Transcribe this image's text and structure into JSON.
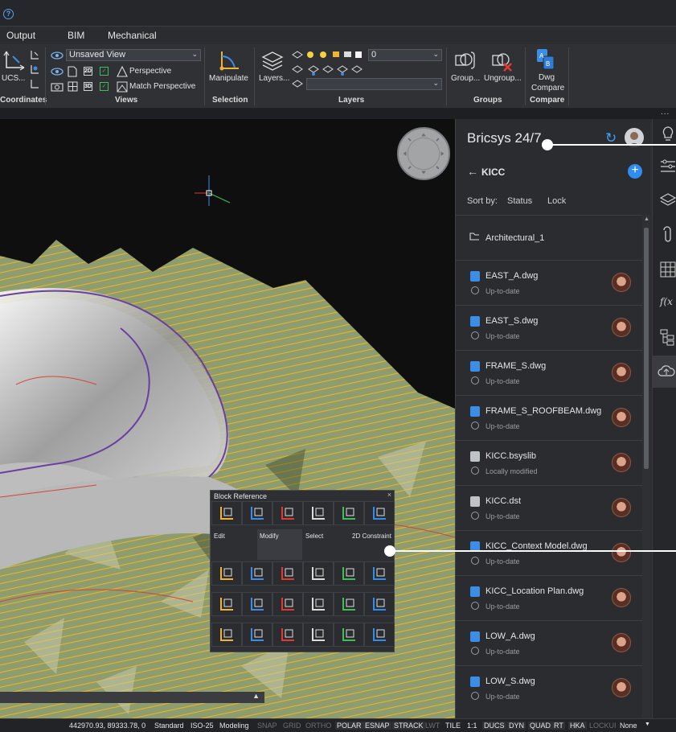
{
  "tabs": [
    "Output",
    "BIM",
    "Mechanical"
  ],
  "ribbon": {
    "coordinates": {
      "ucs_label": "UCS...",
      "group_label": "Coordinates"
    },
    "views": {
      "view_combo": "Unsaved View",
      "perspective": "Perspective",
      "match_perspective": "Match Perspective",
      "group_label": "Views",
      "mini_2d": "2D",
      "mini_3d": "3D"
    },
    "selection": {
      "manipulate": "Manipulate",
      "group_label": "Selection"
    },
    "layers": {
      "layers_btn": "Layers...",
      "layer_value": "0",
      "group_label": "Layers"
    },
    "groups": {
      "group_btn": "Group...",
      "ungroup_btn": "Ungroup...",
      "group_label": "Groups"
    },
    "compare": {
      "dwg_compare": "Dwg Compare",
      "dwg_compare_line1": "Dwg",
      "dwg_compare_line2": "Compare",
      "group_label": "Compare"
    }
  },
  "panel": {
    "title": "Bricsys 24/7",
    "project": "KICC",
    "sort_by": "Sort by:",
    "sort_status": "Status",
    "sort_lock": "Lock",
    "folder": "Architectural_1",
    "files": [
      {
        "name": "EAST_A.dwg",
        "status": "Up-to-date",
        "kind": "dwg"
      },
      {
        "name": "EAST_S.dwg",
        "status": "Up-to-date",
        "kind": "dwg"
      },
      {
        "name": "FRAME_S.dwg",
        "status": "Up-to-date",
        "kind": "dwg"
      },
      {
        "name": "FRAME_S_ROOFBEAM.dwg",
        "status": "Up-to-date",
        "kind": "dwg"
      },
      {
        "name": "KICC.bsyslib",
        "status": "Locally modified",
        "kind": "doc"
      },
      {
        "name": "KICC.dst",
        "status": "Up-to-date",
        "kind": "doc"
      },
      {
        "name": "KICC_Context Model.dwg",
        "status": "Up-to-date",
        "kind": "dwg"
      },
      {
        "name": "KICC_Location Plan.dwg",
        "status": "Up-to-date",
        "kind": "dwg"
      },
      {
        "name": "LOW_A.dwg",
        "status": "Up-to-date",
        "kind": "dwg"
      },
      {
        "name": "LOW_S.dwg",
        "status": "Up-to-date",
        "kind": "dwg"
      }
    ]
  },
  "block_reference": {
    "title": "Block Reference",
    "close": "×",
    "sections": [
      "Edit",
      "Modify",
      "Select",
      "2D Constraint"
    ]
  },
  "statusbar": {
    "coords": "442970.93, 89333.78, 0",
    "items": [
      "Standard",
      "ISO-25",
      "Modeling",
      "SNAP",
      "GRID",
      "ORTHO",
      "POLAR",
      "ESNAP",
      "STRACK",
      "LWT",
      "TILE",
      "1:1",
      "DUCS",
      "DYN",
      "QUAD",
      "RT",
      "HKA",
      "LOCKUI",
      "None"
    ]
  },
  "colors": {
    "accent": "#2f8cf0",
    "panel_bg": "#2b2c30",
    "terrain": "#8a9868",
    "contour": "#e0b82a"
  }
}
